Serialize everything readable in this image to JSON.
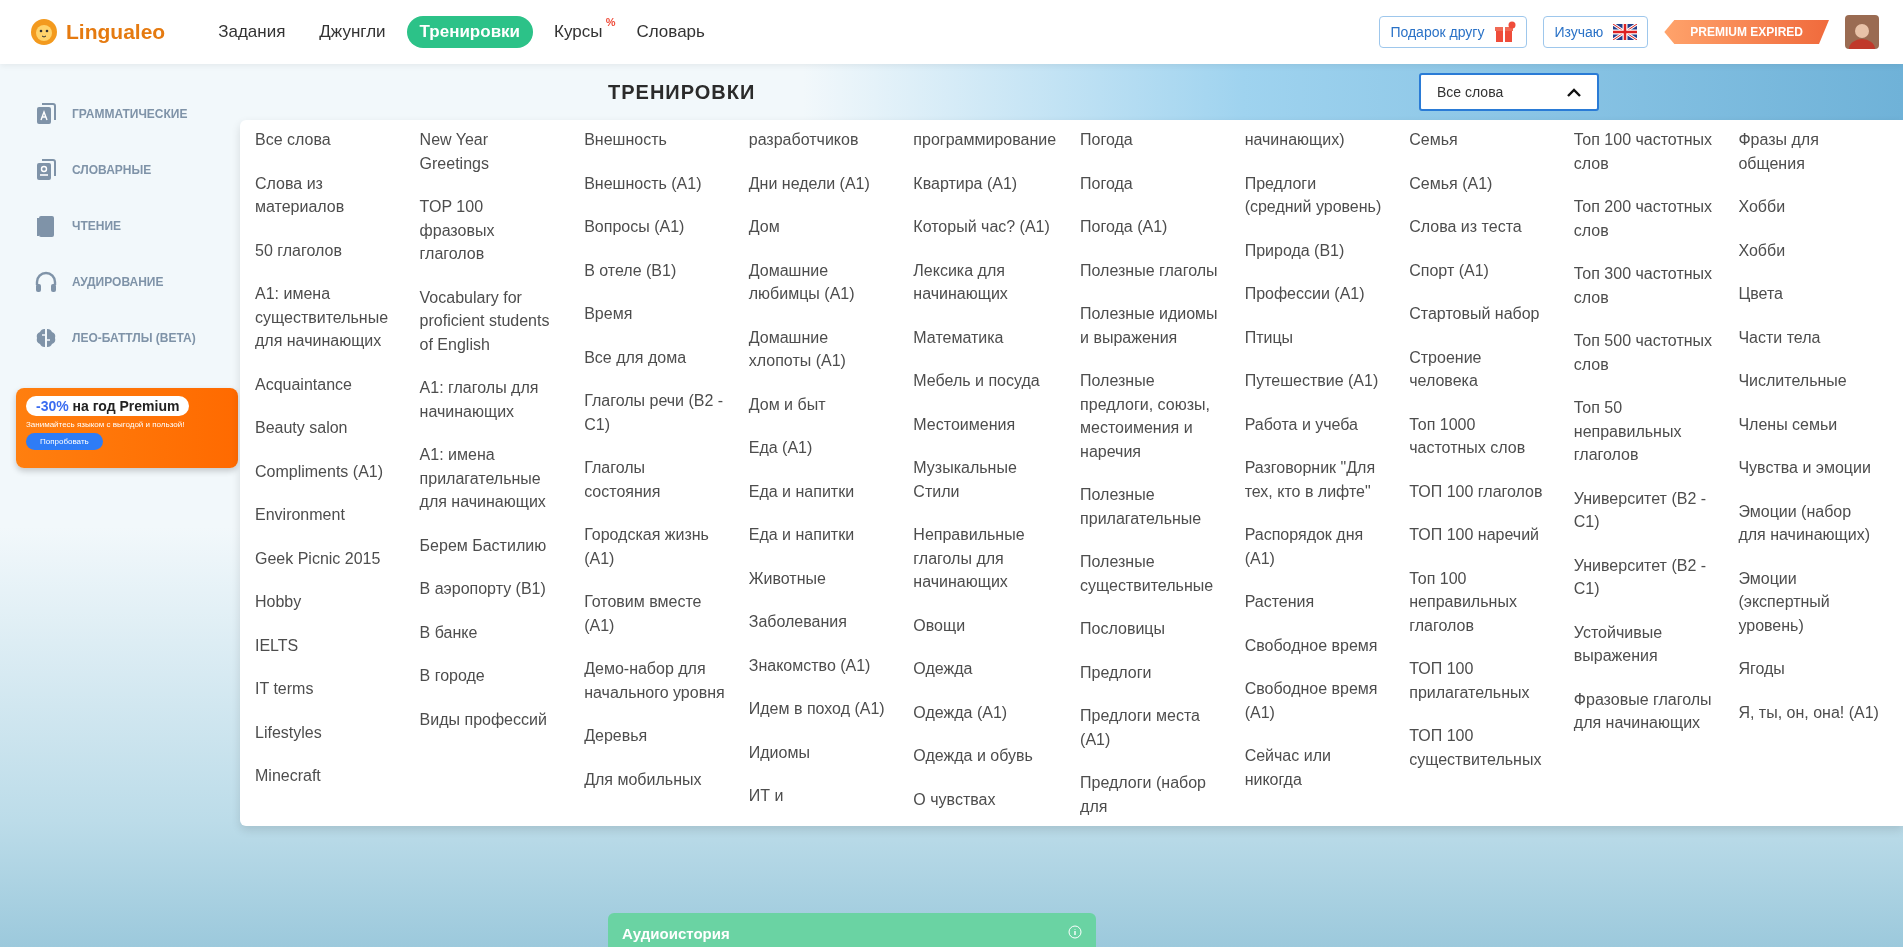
{
  "header": {
    "logo": "Lingualeo",
    "nav": [
      {
        "label": "Задания",
        "selected": false
      },
      {
        "label": "Джунгли",
        "selected": false
      },
      {
        "label": "Тренировки",
        "selected": true
      },
      {
        "label": "Курсы",
        "selected": false,
        "badge": "%"
      },
      {
        "label": "Словарь",
        "selected": false
      }
    ],
    "gift_button": "Подарок другу",
    "learning_button": "Изучаю",
    "premium_badge": "PREMIUM EXPIRED"
  },
  "sidebar": {
    "items": [
      {
        "label": "ГРАММАТИЧЕСКИЕ"
      },
      {
        "label": "СЛОВАРНЫЕ"
      },
      {
        "label": "ЧТЕНИЕ"
      },
      {
        "label": "АУДИРОВАНИЕ"
      },
      {
        "label": "ЛЕО-БАТТЛЫ (BETA)"
      }
    ]
  },
  "promo": {
    "accent": "-30%",
    "headline": "на год Premium",
    "text": "Занимайтесь языком с выгодой и пользой!",
    "button": "Попробовать"
  },
  "page_title": "ТРЕНИРОВКИ",
  "word_set_select": {
    "value": "Все слова",
    "expanded": true
  },
  "word_sets": {
    "columns": [
      [
        "Все слова",
        "Слова из материалов",
        "50 глаголов",
        "A1: имена существительные для начинающих",
        "Acquaintance",
        "Beauty salon",
        "Compliments (A1)",
        "Environment",
        "Geek Picnic 2015",
        "Hobby",
        "IELTS",
        "IT terms",
        "Lifestyles",
        "Minecraft"
      ],
      [
        "New Year Greetings",
        "TOP 100 фразовых глаголов",
        "Vocabulary for proficient students of English",
        "A1: глаголы для начинающих",
        "A1: имена прилагательные для начинающих",
        "Берем Бастилию",
        "В аэропорту (B1)",
        "В банке",
        "В городе",
        "Виды профессий"
      ],
      [
        "Внешность",
        "Внешность (A1)",
        "Вопросы (A1)",
        "В отеле (B1)",
        "Время",
        "Все для дома",
        "Глаголы речи (B2 - C1)",
        "Глаголы состояния",
        "Городская жизнь (A1)",
        "Готовим вместе (A1)",
        "Демо-набор для начального уровня",
        "Деревья",
        "Для мобильных"
      ],
      [
        "разработчиков",
        "Дни недели (A1)",
        "Дом",
        "Домашние любимцы (A1)",
        "Домашние хлопоты (A1)",
        "Дом и быт",
        "Еда (A1)",
        "Еда и напитки",
        "Еда и напитки",
        "Животные",
        "Заболевания",
        "Знакомство (A1)",
        "Идем в поход (A1)",
        "Идиомы",
        "ИТ и"
      ],
      [
        "программирование",
        "Квартира (A1)",
        "Который час? (A1)",
        "Лексика для начинающих",
        "Математика",
        "Мебель и посуда",
        "Местоимения",
        "Музыкальные Стили",
        "Неправильные глаголы для начинающих",
        "Овощи",
        "Одежда",
        "Одежда (A1)",
        "Одежда и обувь",
        "О чувствах"
      ],
      [
        "Погода",
        "Погода",
        "Погода (A1)",
        "Полезные глаголы",
        "Полезные идиомы и выражения",
        "Полезные предлоги, союзы, местоимения и наречия",
        "Полезные прилагательные",
        "Полезные существительные",
        "Пословицы",
        "Предлоги",
        "Предлоги места (A1)",
        "Предлоги (набор для"
      ],
      [
        "начинающих)",
        "Предлоги (средний уровень)",
        "Природа (B1)",
        "Профессии (A1)",
        "Птицы",
        "Путешествие (A1)",
        "Работа и учеба",
        "Разговорник \"Для тех, кто в лифте\"",
        "Распорядок дня (A1)",
        "Растения",
        "Свободное время",
        "Свободное время (A1)",
        "Сейчас или никогда"
      ],
      [
        "Семья",
        "Семья (A1)",
        "Слова из теста",
        "Спорт (A1)",
        "Стартовый набор",
        "Строение человека",
        "Топ 1000 частотных слов",
        "ТОП 100 глаголов",
        "ТОП 100 наречий",
        "Топ 100 неправильных глаголов",
        "ТОП 100 прилагательных",
        "ТОП 100 существительных"
      ],
      [
        "Топ 100 частотных слов",
        "Топ 200 частотных слов",
        "Топ 300 частотных слов",
        "Топ 500 частотных слов",
        "Топ 50 неправильных глаголов",
        "Университет (B2 - C1)",
        "Университет (B2 - C1)",
        "Устойчивые выражения",
        "Фразовые глаголы для начинающих"
      ],
      [
        "Фразы для общения",
        "Хобби",
        "Хобби",
        "Цвета",
        "Части тела",
        "Числительные",
        "Члены семьи",
        "Чувства и эмоции",
        "Эмоции (набор для начинающих)",
        "Эмоции (экспертный уровень)",
        "Ягоды",
        "Я, ты, он, она! (A1)"
      ]
    ]
  },
  "audio_card": {
    "title": "Аудиоистория"
  }
}
